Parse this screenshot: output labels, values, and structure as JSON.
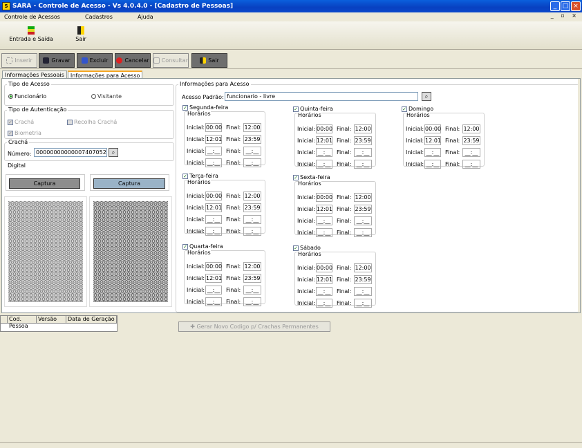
{
  "window": {
    "title": "SARA - Controle de Acesso - Vs 4.0.4.0 - [Cadastro de Pessoas]"
  },
  "menu": [
    "Controle de Acessos",
    "Cadastros",
    "Ajuda"
  ],
  "big_toolbar": {
    "entrada": "Entrada e Saída",
    "sair": "Sair"
  },
  "cmd": {
    "inserir": "Inserir",
    "gravar": "Gravar",
    "excluir": "Excluir",
    "cancelar": "Cancelar",
    "consultar": "Consultar",
    "sair": "Sair"
  },
  "tabs": [
    "Informações Pessoais",
    "Informações para Acesso"
  ],
  "tipo_acesso": {
    "legend": "Tipo de Acesso",
    "funcionario": "Funcionário",
    "visitante": "Visitante"
  },
  "autenticacao": {
    "legend": "Tipo de Autenticação",
    "cracha": "Crachá",
    "recolha": "Recolha Crachá",
    "biometria": "Biometria"
  },
  "cracha": {
    "legend": "Crachá",
    "numero_label": "Número:",
    "numero": "00000000000007407052"
  },
  "digital": {
    "legend": "Digital",
    "captura1": "Captura",
    "captura2": "Captura"
  },
  "info_acesso": {
    "legend": "Informações para Acesso",
    "padrao_label": "Acesso Padrão:",
    "padrao": "funcionario - livre"
  },
  "labels": {
    "horarios": "Horários",
    "inicial": "Inicial:",
    "final": "Final:"
  },
  "days": [
    {
      "name": "Segunda-feira",
      "slots": [
        [
          "00:00",
          "12:00"
        ],
        [
          "12:01",
          "23:59"
        ],
        [
          "__:__",
          "__:__"
        ],
        [
          "__:__",
          "__:__"
        ]
      ]
    },
    {
      "name": "Quinta-feira",
      "slots": [
        [
          "00:00",
          "12:00"
        ],
        [
          "12:01",
          "23:59"
        ],
        [
          "__:__",
          "__:__"
        ],
        [
          "__:__",
          "__:__"
        ]
      ]
    },
    {
      "name": "Domingo",
      "slots": [
        [
          "00:00",
          "12:00"
        ],
        [
          "12:01",
          "23:59"
        ],
        [
          "__:__",
          "__:__"
        ],
        [
          "__:__",
          "__:__"
        ]
      ]
    },
    {
      "name": "Terça-feira",
      "slots": [
        [
          "00:00",
          "12:00"
        ],
        [
          "12:01",
          "23:59"
        ],
        [
          "__:__",
          "__:__"
        ],
        [
          "__:__",
          "__:__"
        ]
      ]
    },
    {
      "name": "Sexta-feira",
      "slots": [
        [
          "00:00",
          "12:00"
        ],
        [
          "12:01",
          "23:59"
        ],
        [
          "__:__",
          "__:__"
        ],
        [
          "__:__",
          "__:__"
        ]
      ]
    },
    {
      "name": "Quarta-feira",
      "slots": [
        [
          "00:00",
          "12:00"
        ],
        [
          "12:01",
          "23:59"
        ],
        [
          "__:__",
          "__:__"
        ],
        [
          "__:__",
          "__:__"
        ]
      ]
    },
    {
      "name": "Sábado",
      "slots": [
        [
          "00:00",
          "12:00"
        ],
        [
          "12:01",
          "23:59"
        ],
        [
          "__:__",
          "__:__"
        ],
        [
          "__:__",
          "__:__"
        ]
      ]
    }
  ],
  "grid": {
    "cols": [
      "Cod. Pessoa",
      "Versão",
      "Data de Geração"
    ]
  },
  "gerar": "Gerar Novo Codigo p/ Crachas Permanentes"
}
